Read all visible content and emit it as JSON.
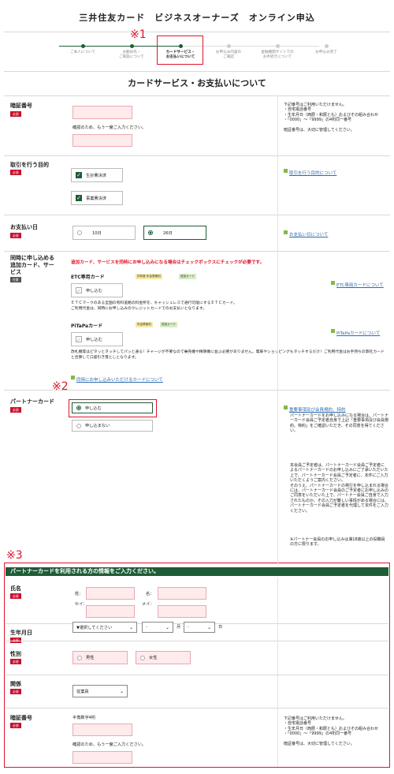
{
  "header": {
    "title": "三井住友カード　ビジネスオーナーズ　オンライン申込"
  },
  "markers": {
    "m1": "※1",
    "m2": "※2",
    "m3": "※3"
  },
  "steps": [
    {
      "label": "ご本人について"
    },
    {
      "label": "お勤め先・\nご家族について"
    },
    {
      "label": "カードサービス・\nお支払いについて"
    },
    {
      "label": "お申込み内容の\nご確認"
    },
    {
      "label": "金融機関サイトでの\nお手続きについて"
    },
    {
      "label": "お申込み完了"
    }
  ],
  "section_title": "カードサービス・お支払いについて",
  "badges": {
    "required": "必須",
    "optional": "任意"
  },
  "pin": {
    "label": "暗証番号",
    "confirm": "確認のため、もう一度ご入力ください。",
    "note": "下記番号はご利用いただけません。\n・自宅電話番号\n・生年月日（西暦・和暦とも）およびその組み合わせ\n・「0000」～「9999」の4桁同一番号\n\n暗証番号は、大切に管理してください。"
  },
  "purpose": {
    "label": "取引を行う目的",
    "options": [
      "生計費決済",
      "事業費決済"
    ],
    "link": "取引を行う目的について"
  },
  "payday": {
    "label": "お支払い日",
    "options": [
      "10日",
      "26日"
    ],
    "selected": "26日",
    "link": "お支払い日について"
  },
  "addcards": {
    "label": "同時に申し込める追加カード、サービス",
    "warning": "追加カード、サービスを同時にお申し込みになる場合はチェックボックスにチェックが必要です。",
    "etc": {
      "name": "ETC専用カード",
      "tags": [
        "初年度 年会費無料",
        "追加カード"
      ],
      "check": "申し込む",
      "link": "ETC専用カードについて",
      "desc": "ＥＴＣマークのある全国の有料道路の料金所を、キャッシュレスで通行可能にするＥＴＣカード。\nご利用代金は、同時にお申し込みのクレジットカードでのお支払いとなります。"
    },
    "pitapa": {
      "name": "PiTaPaカード",
      "tags": [
        "年会費無料",
        "追加カード"
      ],
      "check": "申し込む",
      "link": "PiTaPaカードについて",
      "desc": "改札機等はピタッとタッチしてパッと通る！チャージが不要なので乗売機や精算機に並ぶ必要がありません。電車やショッピングもタッチするだけ！ご利用代金はお手持ちの弊社カードと合算して口座引き落としとなります。"
    },
    "footlink": "同時にお申し込みいただけるカードについて"
  },
  "partner": {
    "label": "パートナーカード",
    "options": [
      "申し込む",
      "申し込まない"
    ],
    "selected": "申し込む",
    "link": "重要事項及び会員規約、特約",
    "note1": "パートナーカードをお申し込みになる場合は、パートナーカード会員ご予定者自身で上記「重要事項及び会員規約、特約」をご確認いただき、その同意を得てください。",
    "note2": "本会員ご予定者は、パートナーカード会員ご予定者によるパートナーカードのお申し込みにご了承いただいた上で、パートナーカード会員ご予定者に、本件にご入力いただくようご案内ください。\nそのうえ、パートナーカードの発行を申し込まれる場合には、パートナーカード会員のご予定者にお申し込みのご同意をいただいた上で、パートナー会員ご自身で入力されたものか、その入力が難しい事情がある場合には、パートナーカード会員ご予定者を代理して本件をご入力ください。",
    "note3": "※パートナー会員のお申し込みは満18歳以上の役職員の方に限ります。"
  },
  "partnerinfo": {
    "bar": "パートナーカードを利用される方の情報をご入力ください。",
    "name": {
      "label": "氏名",
      "sei": "姓：",
      "mei": "名：",
      "sei_kana": "セイ：",
      "mei_kana": "メイ："
    },
    "birth": {
      "label": "生年月日",
      "year": "▼選択してください",
      "month": "-",
      "day": "-",
      "month_unit": "月",
      "day_unit": "日"
    },
    "gender": {
      "label": "性別",
      "options": [
        "男性",
        "女性"
      ]
    },
    "relation": {
      "label": "関係",
      "value": "従業員"
    },
    "pin": {
      "label": "暗証番号",
      "hint": "半角数字4桁",
      "confirm": "確認のため、もう一度ご入力ください。"
    }
  },
  "colors": {
    "accent": "#1e5c36",
    "marker": "#e0142b",
    "link": "#2b6cb0"
  }
}
